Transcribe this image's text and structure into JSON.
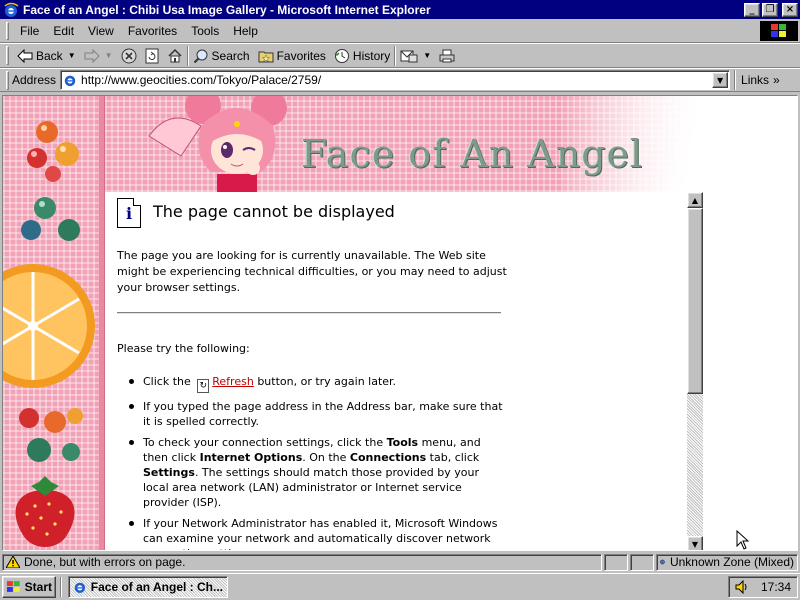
{
  "window": {
    "title": "Face of an Angel : Chibi Usa Image Gallery - Microsoft Internet Explorer",
    "minimize": "_",
    "maximize": "❐",
    "close": "×"
  },
  "menu": {
    "items": [
      "File",
      "Edit",
      "View",
      "Favorites",
      "Tools",
      "Help"
    ]
  },
  "toolbar": {
    "back_label": "Back",
    "search_label": "Search",
    "favorites_label": "Favorites",
    "history_label": "History"
  },
  "address": {
    "label": "Address",
    "url": "http://www.geocities.com/Tokyo/Palace/2759/",
    "links_label": "Links"
  },
  "page": {
    "banner_title": "Face of An Angel",
    "error_title": "The page cannot be displayed",
    "error_description": "The page you are looking for is currently unavailable. The Web site might be experiencing technical difficulties, or you may need to adjust your browser settings.",
    "please_try": "Please try the following:",
    "tip1_before": "Click the",
    "tip1_link": "Refresh",
    "tip1_after": "button, or try again later.",
    "tip2": "If you typed the page address in the Address bar, make sure that it is spelled correctly.",
    "tip3_a": "To check your connection settings, click the ",
    "tip3_b": "Tools",
    "tip3_c": " menu, and then click ",
    "tip3_d": "Internet Options",
    "tip3_e": ". On the ",
    "tip3_f": "Connections",
    "tip3_g": " tab, click ",
    "tip3_h": "Settings",
    "tip3_i": ". The settings should match those provided by your local area network (LAN) administrator or Internet service provider (ISP).",
    "tip4": "If your Network Administrator has enabled it, Microsoft Windows can examine your network and automatically discover network connection settings."
  },
  "status": {
    "message": "Done, but with errors on page.",
    "zone": "Unknown Zone (Mixed)"
  },
  "taskbar": {
    "start_label": "Start",
    "task_label": "Face of an Angel : Ch...",
    "clock": "17:34"
  },
  "colors": {
    "titlebar": "#000080",
    "chrome": "#c0c0c0",
    "link": "#c00000",
    "banner_pink": "#f2a2b6"
  }
}
